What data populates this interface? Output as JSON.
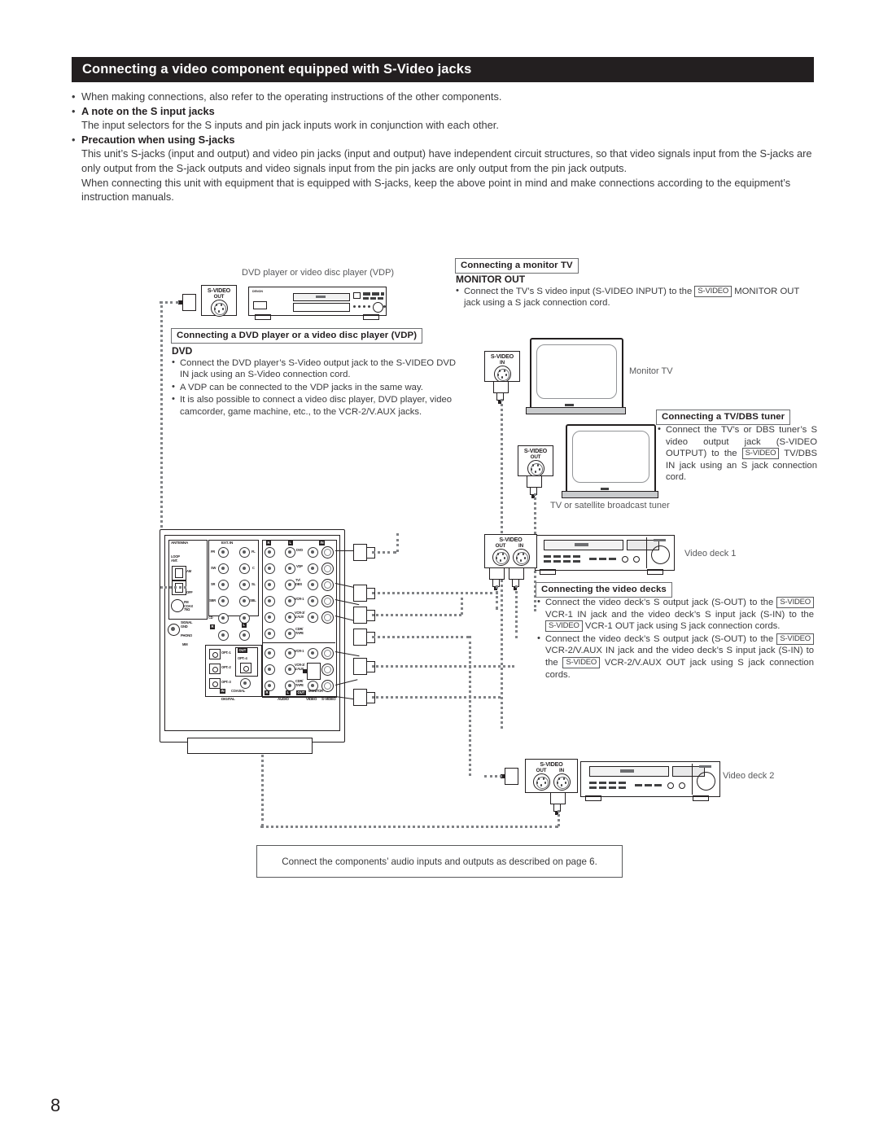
{
  "header": {
    "title": "Connecting a video component equipped with S-Video jacks"
  },
  "intro": {
    "line1": "When making connections, also refer to the operating instructions of the other components.",
    "heading1": "A note on the S input jacks",
    "line2": "The input selectors for the S inputs and pin jack inputs work in conjunction with each other.",
    "heading2": "Precaution when using S-jacks",
    "para1": "This unit’s S-jacks (input and output) and video pin jacks (input and output) have independent circuit structures, so that video signals input  from the S-jacks are only output from the S-jack outputs and video signals input from the pin jacks are only output from the pin jack outputs.",
    "para2": "When connecting this unit with equipment that is equipped with S-jacks, keep the above point in mind and make connections according to the equipment’s instruction manuals."
  },
  "dvd": {
    "caption": "DVD player or video disc player (VDP)",
    "box_title": "Connecting a DVD player or a video disc player (VDP)",
    "sub": "DVD",
    "b1": "Connect the DVD player’s S-Video output jack to the S-VIDEO DVD IN jack using an S-Video connection cord.",
    "b2": "A VDP can be connected to the VDP jacks in the same way.",
    "b3": "It is also possible to connect a video disc player, DVD player, video camcorder, game machine, etc., to the VCR-2/V.AUX jacks.",
    "jack_title": "S-VIDEO",
    "jack_sub": "OUT"
  },
  "monitor": {
    "box_title": "Connecting a monitor TV",
    "sub": "MONITOR OUT",
    "b1_a": "Connect the TV’s S video input (S-VIDEO INPUT) to the",
    "b1_tag": "S-VIDEO",
    "b1_b": "MONITOR OUT jack using a S jack connection cord.",
    "label": "Monitor TV",
    "jack_title": "S-VIDEO",
    "jack_sub": "IN"
  },
  "tuner": {
    "box_title": "Connecting a TV/DBS tuner",
    "b1_a": "Connect the TV’s or DBS tuner’s S video output jack (S-VIDEO OUTPUT) to the",
    "b1_tag": "S-VIDEO",
    "b1_b": "TV/DBS IN jack using an S jack connection cord.",
    "label": "TV or satellite broadcast tuner",
    "jack_title": "S-VIDEO",
    "jack_sub": "OUT"
  },
  "decks": {
    "box_title": "Connecting the video decks",
    "b1_a": "Connect the video deck’s S output jack (S-OUT) to the",
    "b1_tag1": "S-VIDEO",
    "b1_b": "VCR-1 IN jack and the video deck’s S input jack (S-IN) to the",
    "b1_tag2": "S-VIDEO",
    "b1_c": "VCR-1 OUT jack using S jack connection cords.",
    "b2_a": "Connect the video deck’s S output jack (S-OUT) to the",
    "b2_tag1": "S-VIDEO",
    "b2_b": "VCR-2/V.AUX IN jack and the video deck’s S input jack (S-IN) to the",
    "b2_tag2": "S-VIDEO",
    "b2_c": "VCR-2/V.AUX OUT jack using S jack connection cords.",
    "deck1_label": "Video deck 1",
    "deck2_label": "Video deck 2",
    "jack_title": "S-VIDEO",
    "jack_out": "OUT",
    "jack_in": "IN"
  },
  "receiver": {
    "antenna": "ANTENNA",
    "loop_ant": "LOOP\nANT.",
    "am": "AM",
    "off": "OFF",
    "fm_coax": "FM\nCOAX\n75Ω",
    "signal_gnd": "SIGNAL\nGND",
    "phono": "PHONO",
    "mm": "MM",
    "ext_in": "EXT. IN",
    "ext_ch": [
      "FR",
      "FL",
      "SW",
      "C",
      "SR",
      "SL",
      "SBR",
      "SBL"
    ],
    "cd": "CD",
    "digital": "DIGITAL",
    "audio": "AUDIO",
    "video": "VIDEO",
    "svideo": "S-VIDEO",
    "monitor": "MONITOR",
    "opt": [
      "OPT.-1",
      "OPT.-2",
      "OPT.-3"
    ],
    "opt4": "OPT.-4",
    "coaxial": "COAXIAL",
    "in_tag": "IN",
    "out_tag": "OUT",
    "r_tag": "R",
    "l_tag": "L",
    "rows_in": [
      "DVD",
      "VDP",
      "TV/\nDBS",
      "VCR-1",
      "VCR-2/\nV.AUX",
      "CDR/\nTAPE"
    ],
    "rows_out": [
      "VCR-1",
      "VCR-2/\nV.AUX",
      "CDR/\nTAPE"
    ]
  },
  "note": {
    "text": "Connect the components’ audio inputs and outputs as described on page 6."
  },
  "page": {
    "number": "8"
  }
}
